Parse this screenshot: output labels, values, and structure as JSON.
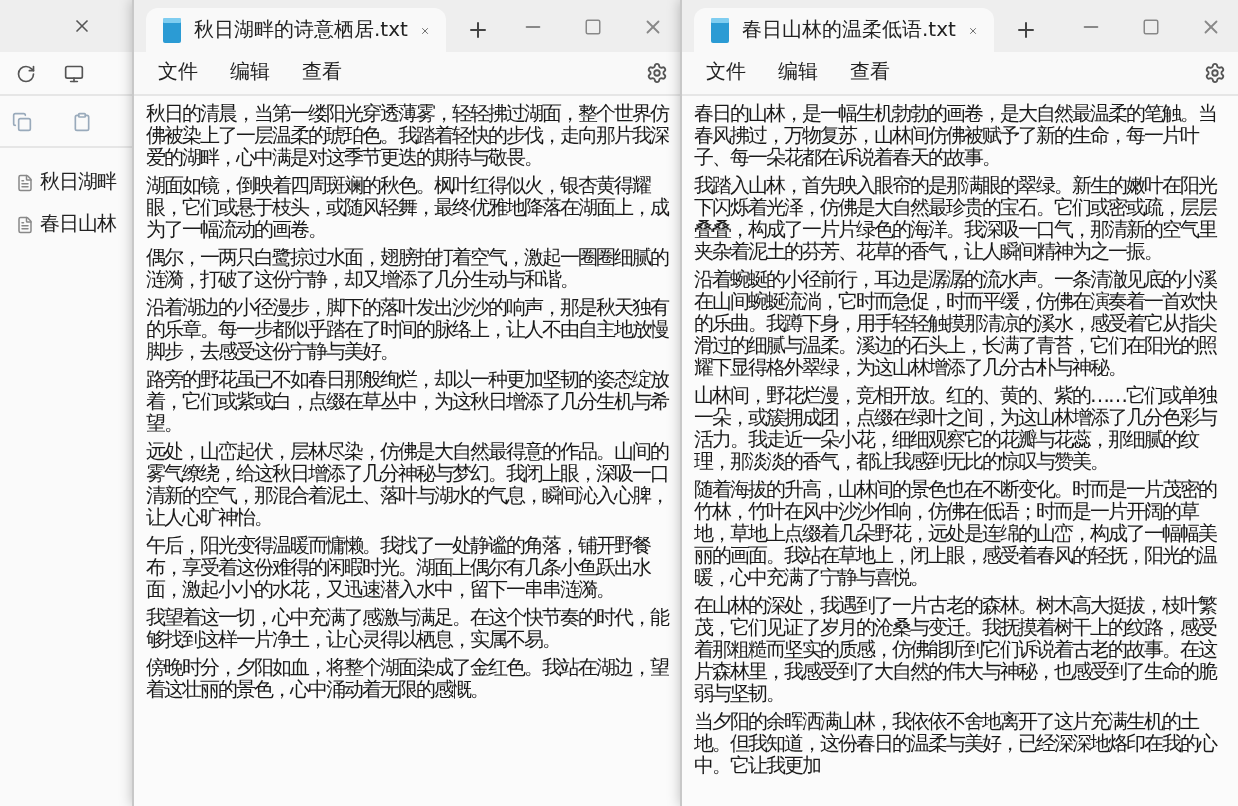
{
  "explorer": {
    "files": [
      "秋日湖畔",
      "春日山林"
    ]
  },
  "windows": [
    {
      "title": "秋日湖畔的诗意栖居.txt",
      "menu": [
        "文件",
        "编辑",
        "查看"
      ],
      "paragraphs": [
        "秋日的清晨，当第一缕阳光穿透薄雾，轻轻拂过湖面，整个世界仿佛被染上了一层温柔的琥珀色。我踏着轻快的步伐，走向那片我深爱的湖畔，心中满是对这季节更迭的期待与敬畏。",
        "湖面如镜，倒映着四周斑斓的秋色。枫叶红得似火，银杏黄得耀眼，它们或悬于枝头，或随风轻舞，最终优雅地降落在湖面上，成为了一幅流动的画卷。",
        "偶尔，一两只白鹭掠过水面，翅膀拍打着空气，激起一圈圈细腻的涟漪，打破了这份宁静，却又增添了几分生动与和谐。",
        "沿着湖边的小径漫步，脚下的落叶发出沙沙的响声，那是秋天独有的乐章。每一步都似乎踏在了时间的脉络上，让人不由自主地放慢脚步，去感受这份宁静与美好。",
        "路旁的野花虽已不如春日那般绚烂，却以一种更加坚韧的姿态绽放着，它们或紫或白，点缀在草丛中，为这秋日增添了几分生机与希望。",
        "远处，山峦起伏，层林尽染，仿佛是大自然最得意的作品。山间的雾气缭绕，给这秋日增添了几分神秘与梦幻。我闭上眼，深吸一口清新的空气，那混合着泥土、落叶与湖水的气息，瞬间沁入心脾，让人心旷神怡。",
        "午后，阳光变得温暖而慵懒。我找了一处静谧的角落，铺开野餐布，享受着这份难得的闲暇时光。湖面上偶尔有几条小鱼跃出水面，激起小小的水花，又迅速潜入水中，留下一串串涟漪。",
        "我望着这一切，心中充满了感激与满足。在这个快节奏的时代，能够找到这样一片净土，让心灵得以栖息，实属不易。",
        "傍晚时分，夕阳如血，将整个湖面染成了金红色。我站在湖边，望着这壮丽的景色，心中涌动着无限的感慨。"
      ]
    },
    {
      "title": "春日山林的温柔低语.txt",
      "menu": [
        "文件",
        "编辑",
        "查看"
      ],
      "paragraphs": [
        "春日的山林，是一幅生机勃勃的画卷，是大自然最温柔的笔触。当春风拂过，万物复苏，山林间仿佛被赋予了新的生命，每一片叶子、每一朵花都在诉说着春天的故事。",
        "我踏入山林，首先映入眼帘的是那满眼的翠绿。新生的嫩叶在阳光下闪烁着光泽，仿佛是大自然最珍贵的宝石。它们或密或疏，层层叠叠，构成了一片片绿色的海洋。我深吸一口气，那清新的空气里夹杂着泥土的芬芳、花草的香气，让人瞬间精神为之一振。",
        "沿着蜿蜒的小径前行，耳边是潺潺的流水声。一条清澈见底的小溪在山间蜿蜒流淌，它时而急促，时而平缓，仿佛在演奏着一首欢快的乐曲。我蹲下身，用手轻轻触摸那清凉的溪水，感受着它从指尖滑过的细腻与温柔。溪边的石头上，长满了青苔，它们在阳光的照耀下显得格外翠绿，为这山林增添了几分古朴与神秘。",
        "山林间，野花烂漫，竞相开放。红的、黄的、紫的……它们或单独一朵，或簇拥成团，点缀在绿叶之间，为这山林增添了几分色彩与活力。我走近一朵小花，细细观察它的花瓣与花蕊，那细腻的纹理，那淡淡的香气，都让我感到无比的惊叹与赞美。",
        "随着海拔的升高，山林间的景色也在不断变化。时而是一片茂密的竹林，竹叶在风中沙沙作响，仿佛在低语；时而是一片开阔的草地，草地上点缀着几朵野花，远处是连绵的山峦，构成了一幅幅美丽的画面。我站在草地上，闭上眼，感受着春风的轻抚，阳光的温暖，心中充满了宁静与喜悦。",
        "在山林的深处，我遇到了一片古老的森林。树木高大挺拔，枝叶繁茂，它们见证了岁月的沧桑与变迁。我抚摸着树干上的纹路，感受着那粗糙而坚实的质感，仿佛能听到它们诉说着古老的故事。在这片森林里，我感受到了大自然的伟大与神秘，也感受到了生命的脆弱与坚韧。",
        "当夕阳的余晖洒满山林，我依依不舍地离开了这片充满生机的土地。但我知道，这份春日的温柔与美好，已经深深地烙印在我的心中。它让我更加"
      ]
    }
  ]
}
